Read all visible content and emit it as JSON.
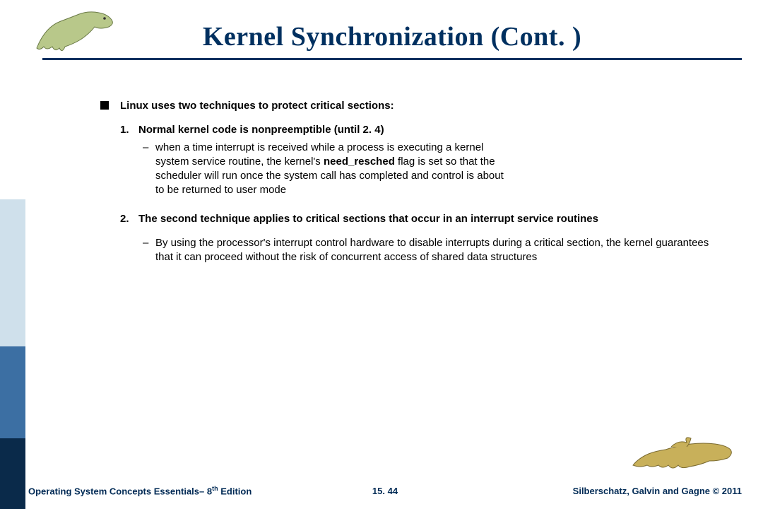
{
  "title": "Kernel Synchronization (Cont. )",
  "lead": "Linux uses two techniques to protect critical sections:",
  "item1": {
    "num": "1.",
    "text": "Normal kernel code is nonpreemptible (until 2. 4)",
    "sub_pre": "when a time interrupt is received while a process is executing a kernel system service routine, the kernel's ",
    "sub_kw": "need_resched",
    "sub_post": " flag is set so that the scheduler will run once the system call has completed and control is about to be returned to user mode"
  },
  "item2": {
    "num": "2.",
    "text": "The second technique applies to critical sections that occur in an interrupt service routines",
    "sub": "By using the processor's interrupt control hardware to disable interrupts during a critical section, the kernel guarantees that it can proceed without the risk of concurrent access of shared data structures"
  },
  "footer": {
    "left_a": "Operating System Concepts Essentials– 8",
    "left_sup": "th",
    "left_b": " Edition",
    "center": "15. 44",
    "right": "Silberschatz, Galvin and Gagne © 2011"
  }
}
